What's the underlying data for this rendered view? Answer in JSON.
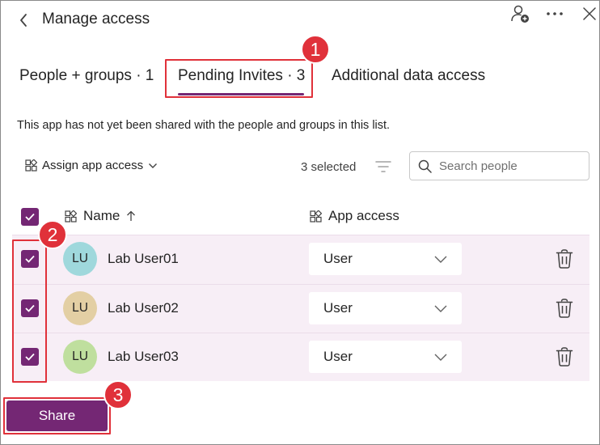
{
  "header": {
    "title": "Manage access",
    "back_icon": "chevron-left-icon",
    "add_person_icon": "person-add-icon",
    "more_icon": "more-horizontal-icon",
    "close_icon": "close-icon"
  },
  "tabs": [
    {
      "label": "People + groups · 1",
      "selected": false
    },
    {
      "label": "Pending Invites · 3",
      "selected": true
    },
    {
      "label": "Additional data access",
      "selected": false
    }
  ],
  "description": "This app has not yet been shared with the people and groups in this list.",
  "toolbar": {
    "assign_label": "Assign app access",
    "selected_count": "3 selected",
    "search_placeholder": "Search people"
  },
  "columns": {
    "name": "Name",
    "name_sort": "ascending",
    "app_access": "App access"
  },
  "rows": [
    {
      "initials": "LU",
      "name": "Lab User01",
      "access": "User",
      "checked": true,
      "avatar_color": "#9fd8dc"
    },
    {
      "initials": "LU",
      "name": "Lab User02",
      "access": "User",
      "checked": true,
      "avatar_color": "#e3cfa4"
    },
    {
      "initials": "LU",
      "name": "Lab User03",
      "access": "User",
      "checked": true,
      "avatar_color": "#bfdf9e"
    }
  ],
  "share_label": "Share",
  "callouts": [
    "1",
    "2",
    "3"
  ],
  "colors": {
    "accent": "#742774",
    "row_selected_bg": "#f7eef6",
    "callout": "#e0313a"
  }
}
